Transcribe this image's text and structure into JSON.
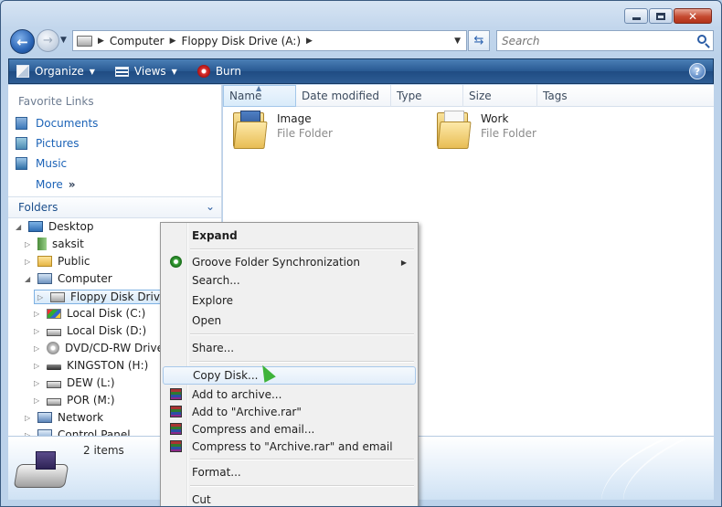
{
  "address": {
    "crumbs": [
      "Computer",
      "Floppy Disk Drive (A:)"
    ]
  },
  "search": {
    "placeholder": "Search"
  },
  "toolbar": {
    "organize": "Organize",
    "views": "Views",
    "burn": "Burn",
    "help": "?"
  },
  "nav": {
    "favorites_title": "Favorite Links",
    "favorites": [
      "Documents",
      "Pictures",
      "Music"
    ],
    "more": "More",
    "folders_title": "Folders",
    "tree": [
      "Desktop",
      "saksit",
      "Public",
      "Computer",
      "Floppy Disk Drive (A:)",
      "Local Disk (C:)",
      "Local Disk (D:)",
      "DVD/CD-RW Drive (E:)",
      "KINGSTON (H:)",
      "DEW (L:)",
      "POR (M:)",
      "Network",
      "Control Panel"
    ]
  },
  "columns": [
    "Name",
    "Date modified",
    "Type",
    "Size",
    "Tags"
  ],
  "files": [
    {
      "name": "Image",
      "type": "File Folder"
    },
    {
      "name": "Work",
      "type": "File Folder"
    }
  ],
  "details": {
    "count": "2 items"
  },
  "context_menu": {
    "expand": "Expand",
    "groove": "Groove Folder Synchronization",
    "search": "Search...",
    "explore": "Explore",
    "open": "Open",
    "share": "Share...",
    "copy_disk": "Copy Disk...",
    "add_archive": "Add to archive...",
    "add_archive_rar": "Add to \"Archive.rar\"",
    "compress_email": "Compress and email...",
    "compress_rar_email": "Compress to \"Archive.rar\" and email",
    "format": "Format...",
    "cut": "Cut"
  },
  "colors": {
    "accent": "#1c63b7",
    "toolbar": "#285992",
    "cursor": "#3eb33a"
  }
}
